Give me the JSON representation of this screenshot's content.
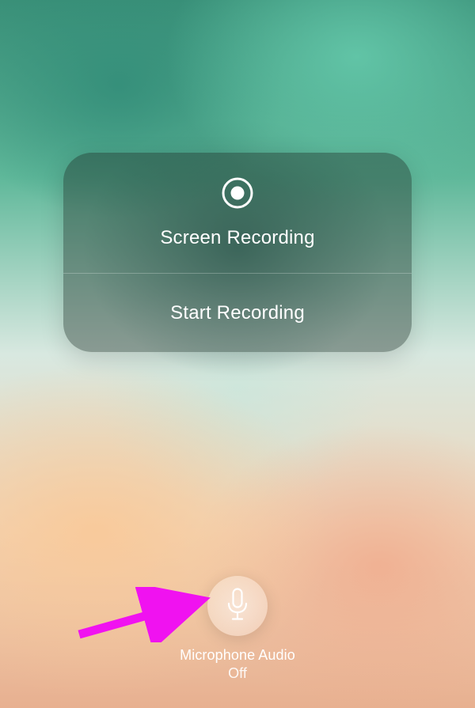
{
  "card": {
    "title": "Screen Recording",
    "action_label": "Start Recording"
  },
  "microphone": {
    "label": "Microphone Audio",
    "status": "Off"
  }
}
